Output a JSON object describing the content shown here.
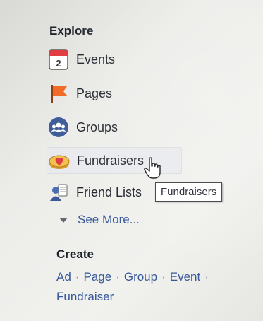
{
  "explore": {
    "title": "Explore",
    "items": [
      {
        "label": "Events",
        "icon": "calendar-icon",
        "calendar_day": "2"
      },
      {
        "label": "Pages",
        "icon": "flag-icon"
      },
      {
        "label": "Groups",
        "icon": "groups-icon"
      },
      {
        "label": "Fundraisers",
        "icon": "fundraiser-icon"
      },
      {
        "label": "Friend Lists",
        "icon": "friend-lists-icon"
      }
    ],
    "see_more": "See More..."
  },
  "create": {
    "title": "Create",
    "links": [
      "Ad",
      "Page",
      "Group",
      "Event",
      "Fundraiser"
    ]
  },
  "tooltip": {
    "text": "Fundraisers"
  },
  "colors": {
    "text": "#1d2129",
    "link": "#365899",
    "hover_bg": "#e9eaed",
    "groups_blue": "#3b5998",
    "flag_orange": "#f26722",
    "calendar_red": "#e0393e"
  }
}
